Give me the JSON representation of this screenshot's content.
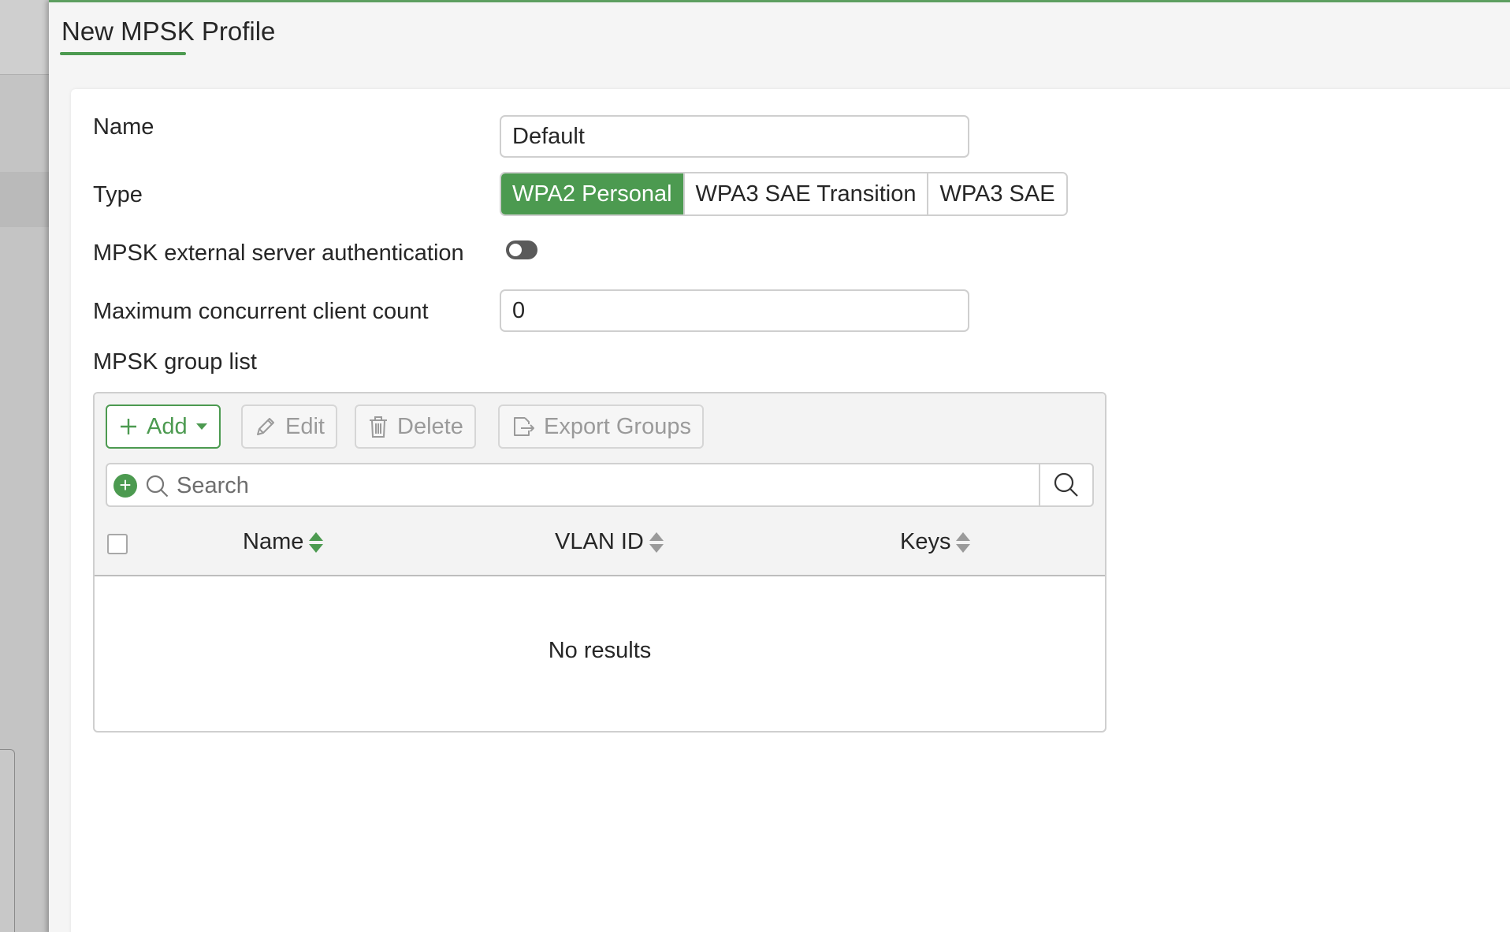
{
  "panel": {
    "title": "New MPSK Profile"
  },
  "form": {
    "name_label": "Name",
    "name_value": "Default",
    "type_label": "Type",
    "type_options": [
      "WPA2 Personal",
      "WPA3 SAE Transition",
      "WPA3 SAE"
    ],
    "type_selected": "WPA2 Personal",
    "external_auth_label": "MPSK external server authentication",
    "external_auth_enabled": false,
    "max_clients_label": "Maximum concurrent client count",
    "max_clients_value": "0",
    "group_list_label": "MPSK group list"
  },
  "toolbar": {
    "add_label": "Add",
    "edit_label": "Edit",
    "delete_label": "Delete",
    "export_label": "Export Groups"
  },
  "search": {
    "placeholder": "Search"
  },
  "table": {
    "columns": [
      "Name",
      "VLAN ID",
      "Keys"
    ],
    "empty_text": "No results"
  },
  "colors": {
    "accent": "#4c9a50"
  }
}
